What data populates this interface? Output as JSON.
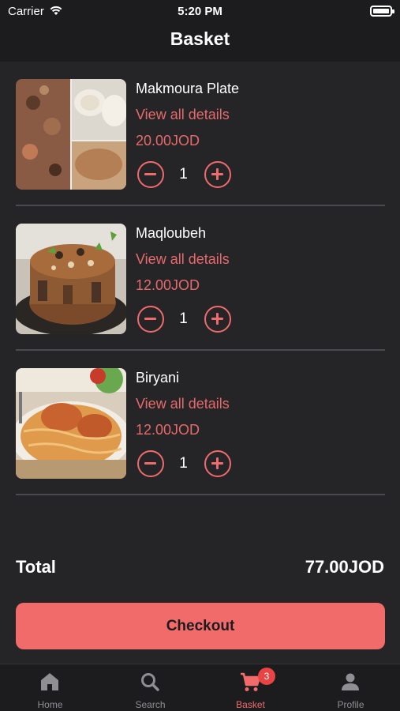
{
  "status": {
    "carrier": "Carrier",
    "time": "5:20 PM"
  },
  "header": {
    "title": "Basket"
  },
  "items": [
    {
      "name": "Makmoura Plate",
      "details_link": "View all details",
      "price": "20.00JOD",
      "quantity": "1"
    },
    {
      "name": "Maqloubeh",
      "details_link": "View all details",
      "price": "12.00JOD",
      "quantity": "1"
    },
    {
      "name": "Biryani",
      "details_link": "View all details",
      "price": "12.00JOD",
      "quantity": "1"
    }
  ],
  "summary": {
    "total_label": "Total",
    "total_value": "77.00JOD"
  },
  "checkout": {
    "label": "Checkout"
  },
  "tabs": [
    {
      "label": "Home",
      "icon": "home-icon"
    },
    {
      "label": "Search",
      "icon": "search-icon"
    },
    {
      "label": "Basket",
      "icon": "cart-icon",
      "badge": "3"
    },
    {
      "label": "Profile",
      "icon": "person-icon"
    }
  ],
  "colors": {
    "accent": "#f26b6b",
    "background": "#252528",
    "bar": "#1c1c1e",
    "badge": "#e84444"
  }
}
